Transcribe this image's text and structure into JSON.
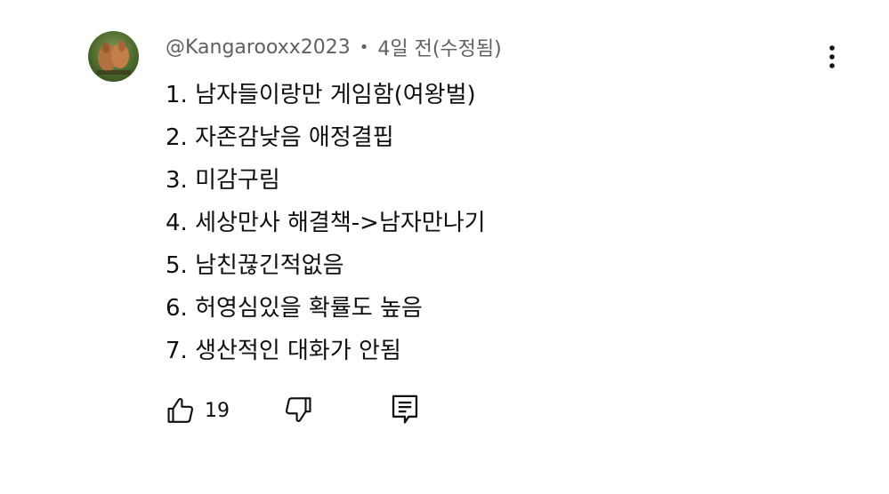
{
  "comment": {
    "author_handle": "@Kangarooxx2023",
    "separator": "•",
    "meta": "4일 전(수정됨)",
    "lines": [
      "1. 남자들이랑만 게임함(여왕벌)",
      "2. 자존감낮음 애정결핍",
      "3. 미감구림",
      "4. 세상만사 해결책->남자만나기",
      "5. 남친끊긴적없음",
      "6. 허영심있을 확률도 높음",
      "7. 생산적인 대화가 안됨"
    ],
    "like_count": "19",
    "icons": {
      "avatar": "avatar-image",
      "more": "more-vertical-icon",
      "like": "thumbs-up-icon",
      "dislike": "thumbs-down-icon",
      "reply": "reply-comment-icon"
    }
  },
  "colors": {
    "text_primary": "#0f0f0f",
    "text_secondary": "#606060",
    "background": "#ffffff"
  }
}
